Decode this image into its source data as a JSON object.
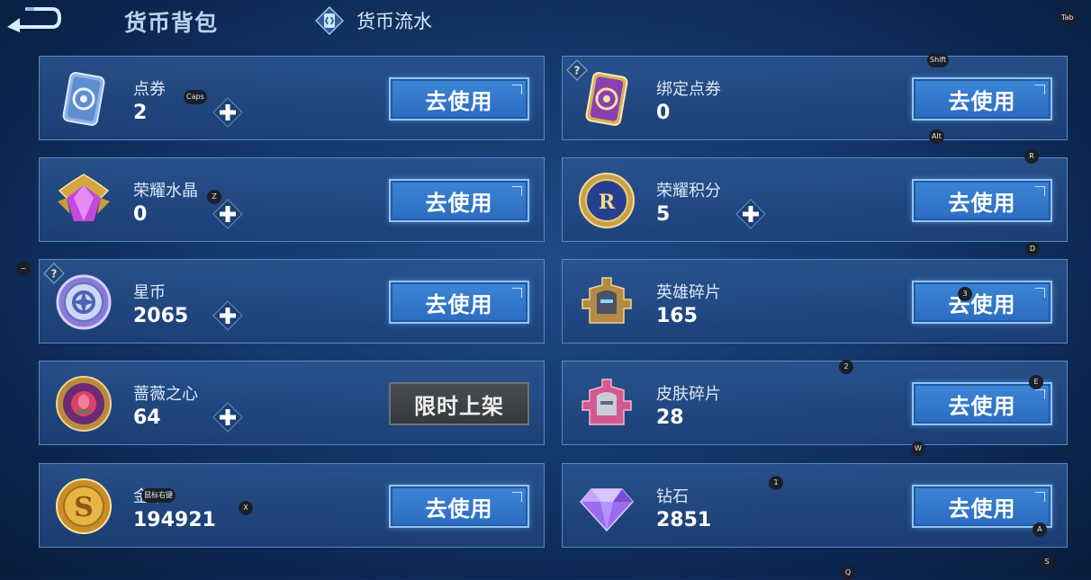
{
  "header": {
    "title": "货币背包",
    "flow_label": "货币流水"
  },
  "colors": {
    "button_blue": "#2f74c8",
    "button_border": "#8ec4ff",
    "card_bg": "#2a528c",
    "card_border": "#5b88c2",
    "disabled_button": "#3e4144"
  },
  "use_label": "去使用",
  "limited_label": "限时上架",
  "currencies_left": [
    {
      "name": "点券",
      "value": "2",
      "icon": "voucher-card-icon",
      "has_plus": true
    },
    {
      "name": "荣耀水晶",
      "value": "0",
      "icon": "glory-crystal-icon",
      "has_plus": true
    },
    {
      "name": "星币",
      "value": "2065",
      "icon": "star-coin-icon",
      "has_plus": true,
      "has_help": true
    },
    {
      "name": "蔷薇之心",
      "value": "64",
      "icon": "rose-heart-icon",
      "has_plus": true
    },
    {
      "name": "金币",
      "value": "194921",
      "icon": "gold-coin-icon",
      "has_plus": false
    }
  ],
  "currencies_right": [
    {
      "name": "绑定点券",
      "value": "0",
      "icon": "bound-voucher-icon",
      "has_plus": false,
      "has_help": true
    },
    {
      "name": "荣耀积分",
      "value": "5",
      "icon": "glory-points-icon",
      "has_plus": true
    },
    {
      "name": "英雄碎片",
      "value": "165",
      "icon": "hero-fragment-icon",
      "has_plus": false
    },
    {
      "name": "皮肤碎片",
      "value": "28",
      "icon": "skin-fragment-icon",
      "has_plus": false
    },
    {
      "name": "钻石",
      "value": "2851",
      "icon": "diamond-icon",
      "has_plus": false
    }
  ],
  "key_hints": {
    "tab": "Tab",
    "shift": "Shift",
    "caps": "Caps",
    "alt": "Alt",
    "r": "R",
    "z": "Z",
    "d": "D",
    "tilde": "~",
    "three": "3",
    "two": "2",
    "e": "E",
    "w": "W",
    "one": "1",
    "x": "X",
    "a": "A",
    "q": "Q",
    "s": "S",
    "mouse": "鼠标右键"
  }
}
